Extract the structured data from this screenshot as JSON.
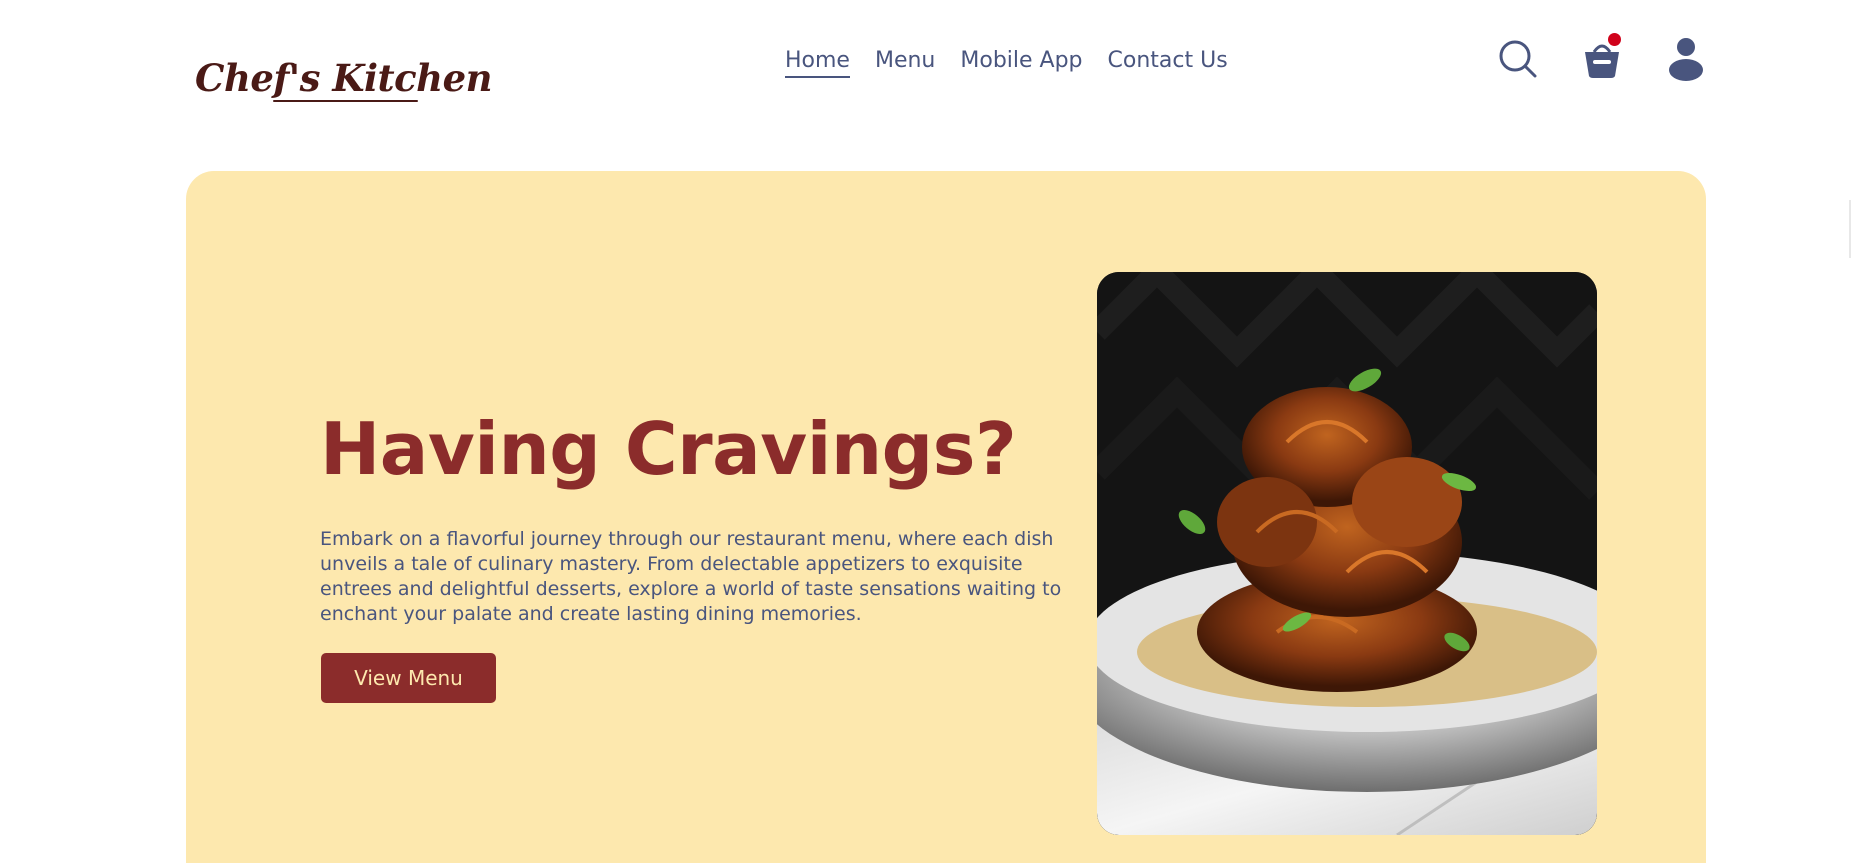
{
  "brand": {
    "name": "Chef's Kitchen"
  },
  "nav": {
    "items": [
      {
        "label": "Home",
        "active": true
      },
      {
        "label": "Menu",
        "active": false
      },
      {
        "label": "Mobile App",
        "active": false
      },
      {
        "label": "Contact Us",
        "active": false
      }
    ]
  },
  "header_icons": {
    "search": "search-icon",
    "cart": "basket-icon",
    "cart_has_items": true,
    "profile": "user-icon"
  },
  "hero": {
    "title": "Having Cravings?",
    "description": "Embark on a flavorful journey through our restaurant menu, where each dish unveils a tale of culinary mastery. From delectable appetizers to exquisite entrees and delightful desserts, explore a world of taste sensations waiting to enchant your palate and create lasting dining memories.",
    "button_label": "View Menu",
    "image": "fried-artichoke-dish-photo"
  },
  "colors": {
    "accent": "#8b2c2b",
    "hero_background": "#fde8ae",
    "text": "#49557e",
    "notification_dot": "#d0021b"
  }
}
